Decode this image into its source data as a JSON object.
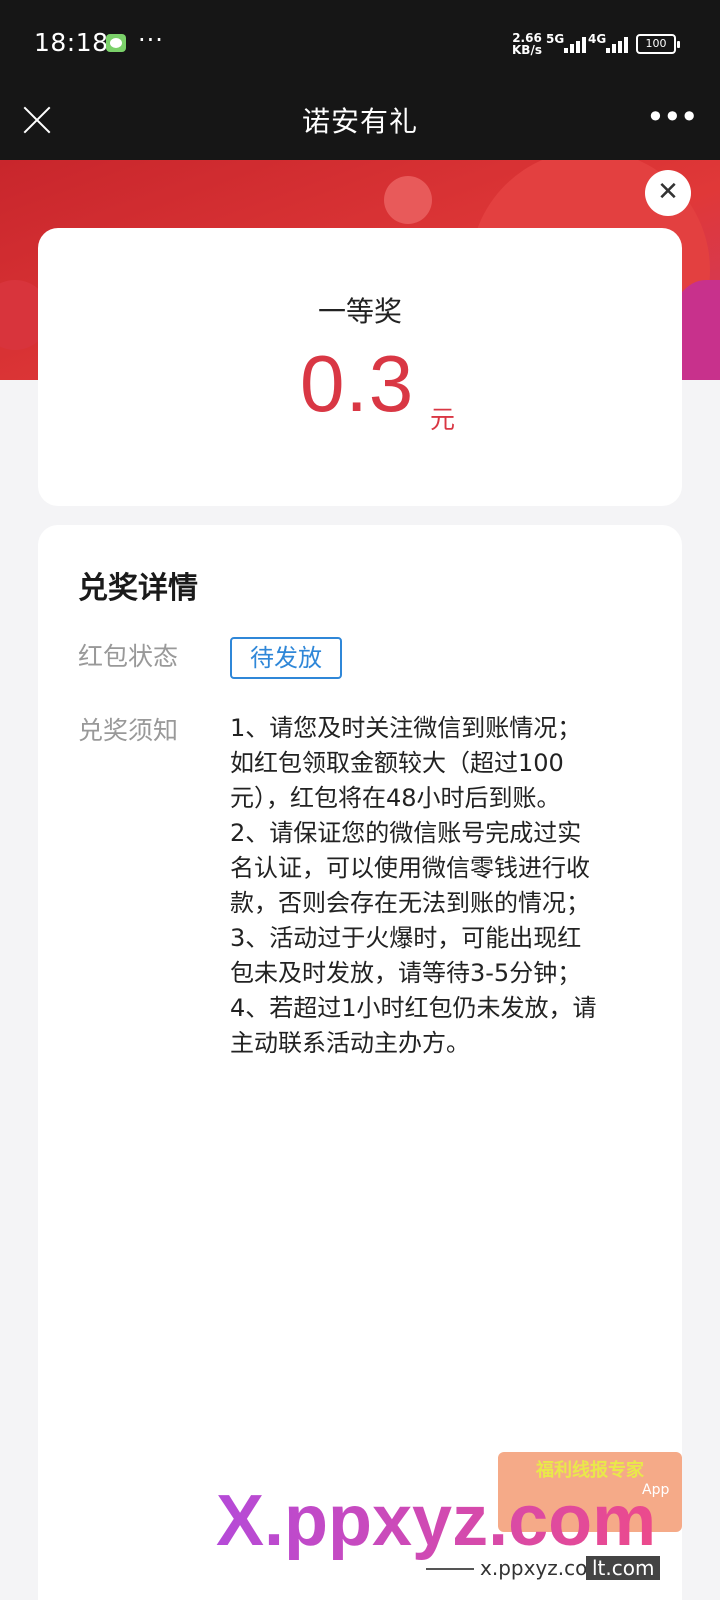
{
  "status_bar": {
    "time": "18:18",
    "dots": "···",
    "net_speed": "2.66",
    "net_unit": "KB/s",
    "signal1": "5G",
    "signal2": "4G",
    "battery": "100"
  },
  "nav": {
    "title": "诺安有礼",
    "more": "•••"
  },
  "popup": {
    "close": "✕"
  },
  "prize": {
    "level": "一等奖",
    "amount": "0.3",
    "unit": "元"
  },
  "detail": {
    "title": "兑奖详情",
    "status_label": "红包状态",
    "status_value": "待发放",
    "notice_label": "兑奖须知",
    "notice_lines": [
      "1、请您及时关注微信到账情况；",
      "如红包领取金额较大（超过100",
      "元），红包将在48小时后到账。",
      "2、请保证您的微信账号完成过实",
      "名认证，可以使用微信零钱进行收",
      "款，否则会存在无法到账的情况；",
      "3、活动过于火爆时，可能出现红",
      "包未及时发放，请等待3-5分钟；",
      "4、若超过1小时红包仍未发放，请",
      "主动联系活动主办方。"
    ]
  },
  "watermark": {
    "brand": "X.ppxyz.com",
    "badge_text": "福利线报专家",
    "app": "App",
    "url": "x.ppxyz.com",
    "url2": "lt.com"
  }
}
